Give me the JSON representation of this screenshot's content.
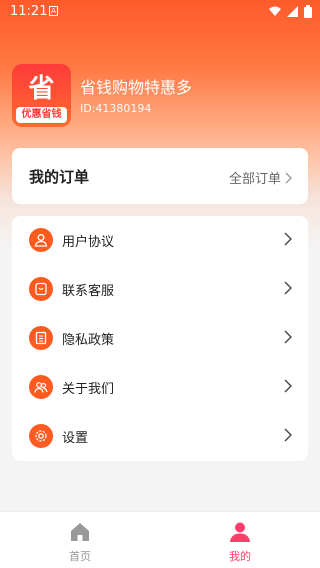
{
  "status_bar": {
    "time": "11:21",
    "notification_letter": "A"
  },
  "profile": {
    "logo_char": "省",
    "logo_sub": "优惠省钱",
    "app_name": "省钱购物特惠多",
    "user_id": "ID:41380194"
  },
  "orders": {
    "title": "我的订单",
    "all_label": "全部订单"
  },
  "menu": {
    "items": [
      {
        "label": "用户协议",
        "icon": "user-agreement-icon"
      },
      {
        "label": "联系客服",
        "icon": "customer-service-icon"
      },
      {
        "label": "隐私政策",
        "icon": "privacy-policy-icon"
      },
      {
        "label": "关于我们",
        "icon": "about-us-icon"
      },
      {
        "label": "设置",
        "icon": "settings-icon"
      }
    ]
  },
  "tabbar": {
    "tabs": [
      {
        "label": "首页",
        "icon": "home-icon",
        "active": false
      },
      {
        "label": "我的",
        "icon": "profile-icon",
        "active": true
      }
    ]
  },
  "colors": {
    "accent": "#ff5a1f",
    "active_tab": "#ff3d6a",
    "inactive_tab": "#999999"
  }
}
